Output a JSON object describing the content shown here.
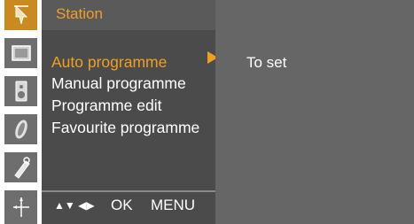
{
  "menu": {
    "title": "Station",
    "items": [
      {
        "label": "Auto programme",
        "selected": true
      },
      {
        "label": "Manual programme",
        "selected": false
      },
      {
        "label": "Programme edit",
        "selected": false
      },
      {
        "label": "Favourite programme",
        "selected": false
      }
    ]
  },
  "footer": {
    "nav_symbols": "▲▼ ◀▶",
    "ok_label": "OK",
    "menu_label": "MENU"
  },
  "info_panel": {
    "text": "To set"
  },
  "sidebar_icons": [
    "station-icon",
    "picture-icon",
    "sound-icon",
    "time-icon",
    "special-icon",
    "screen-icon"
  ],
  "colors": {
    "accent": "#f0a020",
    "menu_bg": "#4b4b4b",
    "info_bg": "#666666"
  }
}
